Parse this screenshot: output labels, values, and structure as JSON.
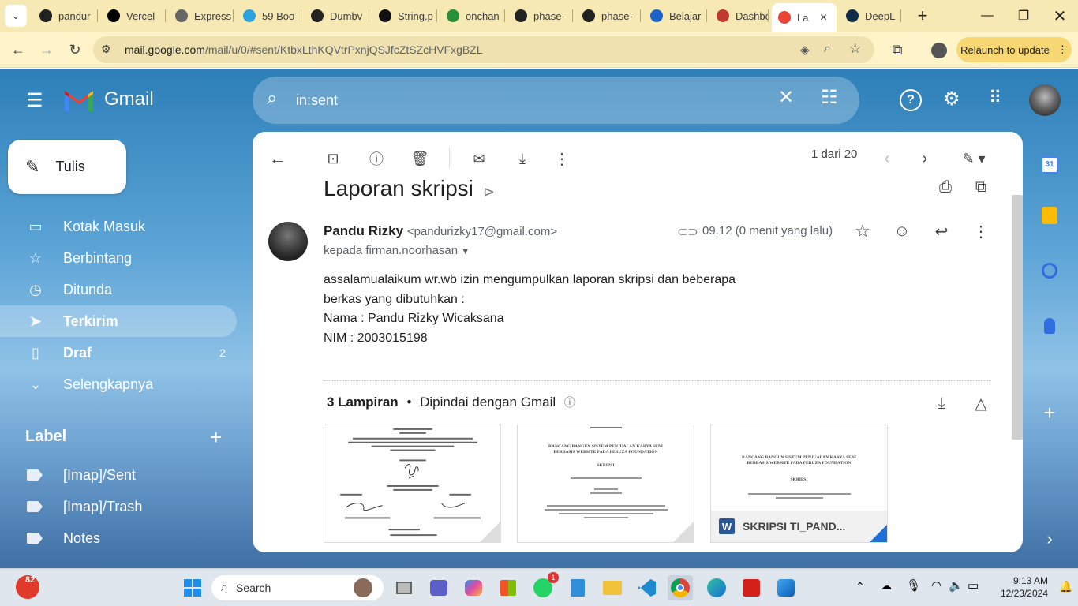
{
  "browser": {
    "tabs": [
      {
        "label": "pandur",
        "icon": "github-icon"
      },
      {
        "label": "Vercel",
        "icon": "vercel-icon"
      },
      {
        "label": "Express",
        "icon": "express-icon"
      },
      {
        "label": "59 Boo",
        "icon": "telegram-icon"
      },
      {
        "label": "Dumbv",
        "icon": "github-icon"
      },
      {
        "label": "String.p",
        "icon": "string-icon"
      },
      {
        "label": "onchan",
        "icon": "w-icon"
      },
      {
        "label": "phase-",
        "icon": "github-icon"
      },
      {
        "label": "phase-",
        "icon": "github-icon"
      },
      {
        "label": "Belajar",
        "icon": "dicoding-icon"
      },
      {
        "label": "Dashbo",
        "icon": "dashboard-icon"
      },
      {
        "label": "La",
        "icon": "gmail-icon",
        "active": true
      },
      {
        "label": "DeepL",
        "icon": "deepl-icon"
      }
    ],
    "url_host": "mail.google.com",
    "url_path": "/mail/u/0/#sent/KtbxLthKQVtrPxnjQSJfcZtSZcHVFxgBZL",
    "relaunch_label": "Relaunch to update"
  },
  "gmail": {
    "brand": "Gmail",
    "search_query": "in:sent",
    "compose_label": "Tulis",
    "nav": [
      {
        "label": "Kotak Masuk",
        "icon": "inbox-icon"
      },
      {
        "label": "Berbintang",
        "icon": "star-icon"
      },
      {
        "label": "Ditunda",
        "icon": "clock-icon"
      },
      {
        "label": "Terkirim",
        "icon": "send-icon",
        "active": true
      },
      {
        "label": "Draf",
        "icon": "draft-icon",
        "count": "2"
      },
      {
        "label": "Selengkapnya",
        "icon": "chevron-down-icon"
      }
    ],
    "labels_heading": "Label",
    "labels": [
      "[Imap]/Sent",
      "[Imap]/Trash",
      "Notes"
    ],
    "pager": "1 dari 20",
    "message": {
      "subject": "Laporan skripsi",
      "sender_name": "Pandu Rizky",
      "sender_email": "<pandurizky17@gmail.com>",
      "to": "kepada firman.noorhasan",
      "time": "09.12 (0 menit yang lalu)",
      "body": [
        "assalamualaikum wr.wb izin mengumpulkan laporan skripsi dan beberapa",
        "berkas yang dibutuhkan :",
        "Nama : Pandu Rizky Wicaksana",
        "NIM : 2003015198"
      ],
      "attachments_count": "3 Lampiran",
      "attachments_note": "Dipindai dengan Gmail",
      "attachment_caption": "SKRIPSI TI_PAND...",
      "thumb2_title": "RANCANG BANGUN SISTEM PENJUALAN KARYA SENI BERBASIS WEBSITE PADA PERUZA FOUNDATION",
      "thumb2_sub": "SKRIPSI",
      "thumb3_title": "RANCANG BANGUN SISTEM PENJUALAN KARYA SENI BERBASIS WEBSITE PADA PERUZA FOUNDATION",
      "thumb3_sub": "SKRIPSI"
    }
  },
  "taskbar": {
    "weather": "82°",
    "search_label": "Search",
    "whatsapp_badge": "1",
    "time": "9:13 AM",
    "date": "12/23/2024"
  }
}
